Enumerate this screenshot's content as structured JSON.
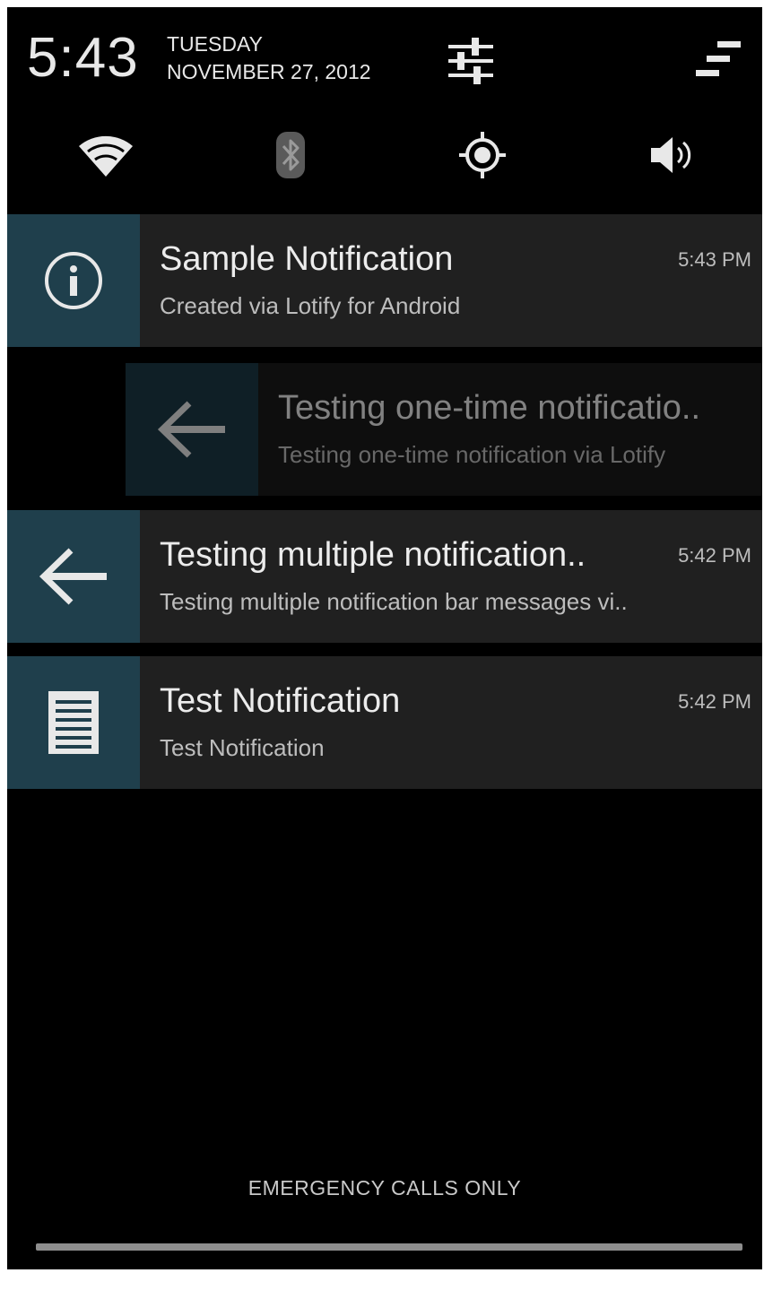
{
  "header": {
    "time": "5:43",
    "day": "TUESDAY",
    "date": "NOVEMBER 27, 2012",
    "settings_icon": "quick-settings-sliders-icon",
    "clear_icon": "clear-all-notifications-icon"
  },
  "quick_settings": [
    {
      "name": "wifi",
      "icon": "wifi-icon"
    },
    {
      "name": "bluetooth",
      "icon": "bluetooth-icon"
    },
    {
      "name": "location",
      "icon": "location-icon"
    },
    {
      "name": "sound",
      "icon": "volume-icon"
    }
  ],
  "notifications": [
    {
      "title": "Sample Notification",
      "text": "Created via Lotify for Android",
      "time": "5:43 PM",
      "icon": "info-icon"
    },
    {
      "title": "Testing one-time notificatio..",
      "text": "Testing one-time notification via Lotify",
      "time": "",
      "icon": "back-arrow-icon",
      "state": "swiping"
    },
    {
      "title": "Testing multiple notification..",
      "text": "Testing multiple notification bar messages vi..",
      "time": "5:42 PM",
      "icon": "back-arrow-icon"
    },
    {
      "title": "Test Notification",
      "text": "Test Notification",
      "time": "5:42 PM",
      "icon": "document-icon"
    }
  ],
  "footer": {
    "carrier_text": "EMERGENCY CALLS ONLY"
  },
  "colors": {
    "background": "#000000",
    "notification_bg": "#202020",
    "icon_box": "#1f3f4c",
    "text_primary": "#ececec",
    "text_secondary": "#bdbdbd"
  }
}
